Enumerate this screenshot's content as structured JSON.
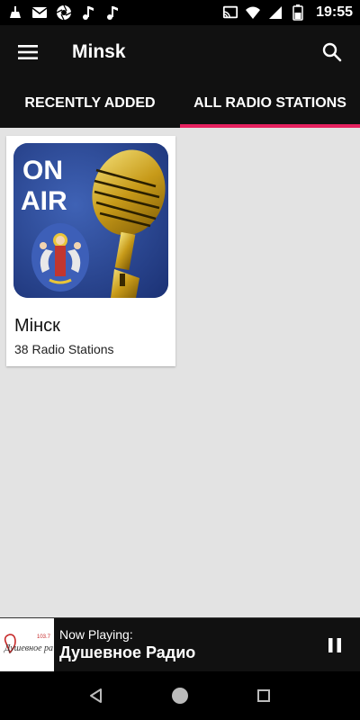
{
  "status_bar": {
    "time": "19:55",
    "left_icons": [
      "cleaner-icon",
      "mail-icon",
      "aperture-icon",
      "music-note-icon",
      "music-note-icon"
    ],
    "right_icons": [
      "cast-icon",
      "wifi-icon",
      "sim-signal-icon",
      "battery-icon"
    ]
  },
  "app_bar": {
    "title": "Minsk",
    "menu_icon": "hamburger-menu-icon",
    "search_icon": "search-icon"
  },
  "tabs": [
    {
      "label": "RECENTLY ADDED",
      "active": false
    },
    {
      "label": "ALL RADIO STATIONS",
      "active": true
    }
  ],
  "cards": [
    {
      "title": "Мінск",
      "subtitle": "38 Radio Stations",
      "badge_text": [
        "ON",
        "AIR"
      ]
    }
  ],
  "now_playing": {
    "label": "Now Playing:",
    "title": "Душевное Радио",
    "logo_text": "Душевное радио",
    "logo_freq": "103.7"
  },
  "colors": {
    "accent": "#e6215f",
    "bar": "#111111",
    "background": "#e3e3e3",
    "card_art_blue": "#2c4a96"
  }
}
